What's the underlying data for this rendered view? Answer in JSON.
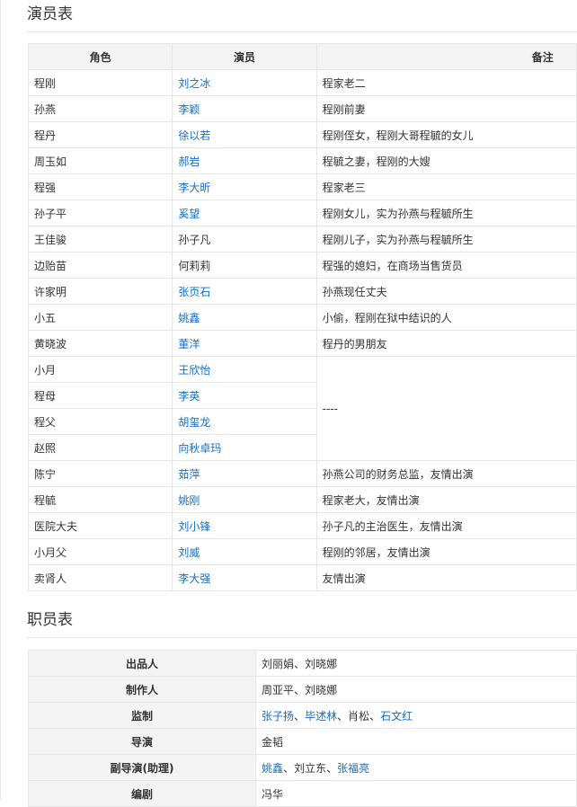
{
  "cast_section": {
    "title": "演员表",
    "headers": {
      "role": "角色",
      "actor": "演员",
      "note": "备注"
    },
    "rows": [
      {
        "role": "程刚",
        "actor": "刘之冰",
        "linked": true,
        "note": "程家老二"
      },
      {
        "role": "孙燕",
        "actor": "李颖",
        "linked": true,
        "note": "程刚前妻"
      },
      {
        "role": "程丹",
        "actor": "徐以若",
        "linked": true,
        "note": "程刚侄女，程刚大哥程毓的女儿"
      },
      {
        "role": "周玉如",
        "actor": "郝岩",
        "linked": true,
        "note": "程毓之妻，程刚的大嫂"
      },
      {
        "role": "程强",
        "actor": "李大昕",
        "linked": true,
        "note": "程家老三"
      },
      {
        "role": "孙子平",
        "actor": "奚望",
        "linked": true,
        "note": "程刚女儿，实为孙燕与程毓所生"
      },
      {
        "role": "王佳骏",
        "actor": "孙子凡",
        "linked": false,
        "note": "程刚儿子，实为孙燕与程毓所生"
      },
      {
        "role": "边贻苗",
        "actor": "何莉莉",
        "linked": false,
        "note": "程强的媳妇，在商场当售货员"
      },
      {
        "role": "许家明",
        "actor": "张页石",
        "linked": true,
        "note": "孙燕现任丈夫"
      },
      {
        "role": "小五",
        "actor": "姚鑫",
        "linked": true,
        "note": "小偷，程刚在狱中结识的人"
      },
      {
        "role": "黄晓波",
        "actor": "董洋",
        "linked": true,
        "note": "程丹的男朋友"
      },
      {
        "role": "小月",
        "actor": "王欣怡",
        "linked": true,
        "note": "----"
      },
      {
        "role": "程母",
        "actor": "李英",
        "linked": true,
        "note": ""
      },
      {
        "role": "程父",
        "actor": "胡玺龙",
        "linked": true,
        "note": ""
      },
      {
        "role": "赵照",
        "actor": "向秋卓玛",
        "linked": true,
        "note": ""
      },
      {
        "role": "陈宁",
        "actor": "茹萍",
        "linked": true,
        "note": "孙燕公司的财务总监，友情出演"
      },
      {
        "role": "程毓",
        "actor": "姚刚",
        "linked": true,
        "note": "程家老大，友情出演"
      },
      {
        "role": "医院大夫",
        "actor": "刘小锋",
        "linked": true,
        "note": "孙子凡的主治医生，友情出演"
      },
      {
        "role": "小月父",
        "actor": "刘威",
        "linked": true,
        "note": "程刚的邻居，友情出演"
      },
      {
        "role": "卖肾人",
        "actor": "李大强",
        "linked": true,
        "note": "友情出演"
      }
    ]
  },
  "crew_section": {
    "title": "职员表",
    "rows": [
      {
        "label": "出品人",
        "names": [
          {
            "t": "刘丽娟",
            "link": false
          },
          {
            "t": "、",
            "link": false
          },
          {
            "t": "刘晓娜",
            "link": false
          }
        ]
      },
      {
        "label": "制作人",
        "names": [
          {
            "t": "周亚平",
            "link": false
          },
          {
            "t": "、",
            "link": false
          },
          {
            "t": "刘晓娜",
            "link": false
          }
        ]
      },
      {
        "label": "监制",
        "names": [
          {
            "t": "张子扬",
            "link": true
          },
          {
            "t": "、",
            "link": false
          },
          {
            "t": "毕述林",
            "link": true
          },
          {
            "t": "、",
            "link": false
          },
          {
            "t": "肖松",
            "link": false
          },
          {
            "t": "、",
            "link": false
          },
          {
            "t": "石文红",
            "link": true
          }
        ]
      },
      {
        "label": "导演",
        "names": [
          {
            "t": "金韬",
            "link": false
          }
        ]
      },
      {
        "label": "副导演(助理)",
        "names": [
          {
            "t": "姚鑫",
            "link": true
          },
          {
            "t": "、",
            "link": false
          },
          {
            "t": "刘立东",
            "link": false
          },
          {
            "t": "、",
            "link": false
          },
          {
            "t": "张福亮",
            "link": true
          }
        ]
      },
      {
        "label": "编剧",
        "names": [
          {
            "t": "冯华",
            "link": false
          }
        ]
      }
    ]
  },
  "colors": {
    "link": "#136ec2",
    "header_bg": "#f3f3f3",
    "border": "#e6e6e6"
  }
}
